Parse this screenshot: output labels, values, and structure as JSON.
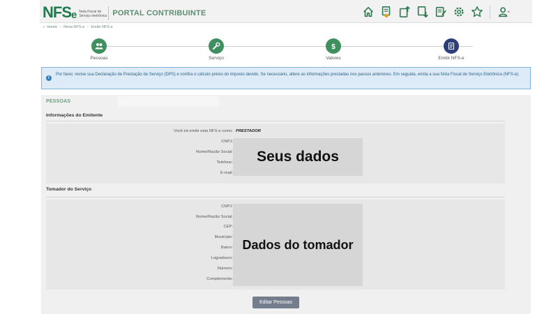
{
  "header": {
    "logo_main": "NFS",
    "logo_e": "e",
    "logo_sub": "Nota Fiscal de Serviço eletrônica",
    "portal_title": "PORTAL CONTRIBUINTE",
    "icons": [
      "home-icon",
      "document-badge-icon",
      "upload-icon",
      "download-icon",
      "edit-document-icon",
      "gear-icon",
      "star-icon",
      "user-icon"
    ]
  },
  "breadcrumb": [
    "Home",
    "Nova NFS-e",
    "Emitir NFS-e"
  ],
  "steps": [
    {
      "label": "Pessoas",
      "icon": "people-icon"
    },
    {
      "label": "Serviço",
      "icon": "wrench-icon"
    },
    {
      "label": "Valores",
      "icon": "dollar-icon"
    },
    {
      "label": "Emitir NFS-e",
      "icon": "document-icon"
    }
  ],
  "info": {
    "text": "Por favor, revise sua Declaração de Prestação de Serviço (DPS) e confira o cálculo prévio do imposto devido. Se necessário, altere as informações prestadas nos passos anteriores. Em seguida, emita a sua Nota Fiscal de Serviço Eletrônica (NFS-e)."
  },
  "section": {
    "title": "PESSOAS",
    "emitente": {
      "title": "Informações do Emitente",
      "fields": [
        {
          "label": "Você irá emitir esta NFS-e como:",
          "value": "PRESTADOR"
        },
        {
          "label": "CNPJ:",
          "value": ""
        },
        {
          "label": "Nome/Razão Social:",
          "value": ""
        },
        {
          "label": "Telefone:",
          "value": ""
        },
        {
          "label": "E-mail:",
          "value": ""
        }
      ],
      "overlay": "Seus dados"
    },
    "tomador": {
      "title": "Tomador do Serviço",
      "fields": [
        {
          "label": "CNPJ:"
        },
        {
          "label": "Nome/Razão Social:"
        },
        {
          "label": "CEP:"
        },
        {
          "label": "Município:"
        },
        {
          "label": "Bairro:"
        },
        {
          "label": "Logradouro:"
        },
        {
          "label": "Número:"
        },
        {
          "label": "Complemento:"
        }
      ],
      "overlay": "Dados do tomador"
    },
    "edit_button": "Editar Pessoas"
  },
  "colors": {
    "brand_green": "#1f7a4d",
    "step_green": "#3f8f5f",
    "step_active": "#2d3e7a",
    "info_bg": "#dcebf7",
    "button": "#747d8c"
  }
}
